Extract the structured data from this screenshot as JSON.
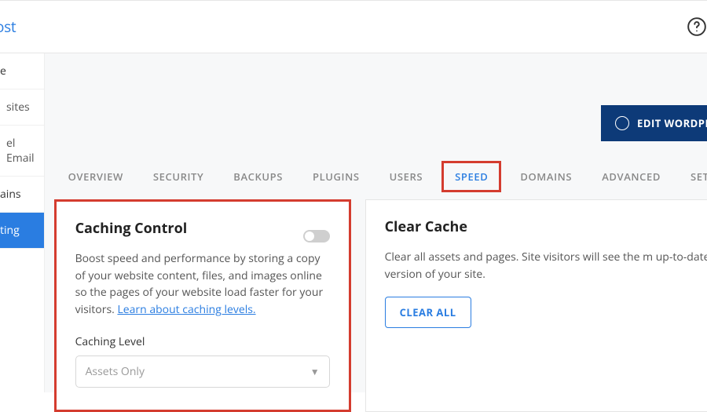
{
  "brand": "ost",
  "sidebar": {
    "items": [
      {
        "label": "e"
      },
      {
        "label": "sites"
      },
      {
        "label": "el Email"
      },
      {
        "label": "ains"
      },
      {
        "label": "ting"
      }
    ]
  },
  "editBtn": "EDIT WORDPRESS",
  "tabs": [
    "OVERVIEW",
    "SECURITY",
    "BACKUPS",
    "PLUGINS",
    "USERS",
    "SPEED",
    "DOMAINS",
    "ADVANCED",
    "SETTINGS"
  ],
  "activeTab": "SPEED",
  "caching": {
    "title": "Caching Control",
    "body1": "Boost speed and performance by storing a copy of your website content, files, and images online so the pages of your website load faster for your visitors. ",
    "learn": "Learn about caching levels.",
    "levelLabel": "Caching Level",
    "levelValue": "Assets Only"
  },
  "clear": {
    "title": "Clear Cache",
    "body": "Clear all assets and pages. Site visitors will see the m up-to-date version of your site.",
    "btn": "CLEAR ALL"
  }
}
